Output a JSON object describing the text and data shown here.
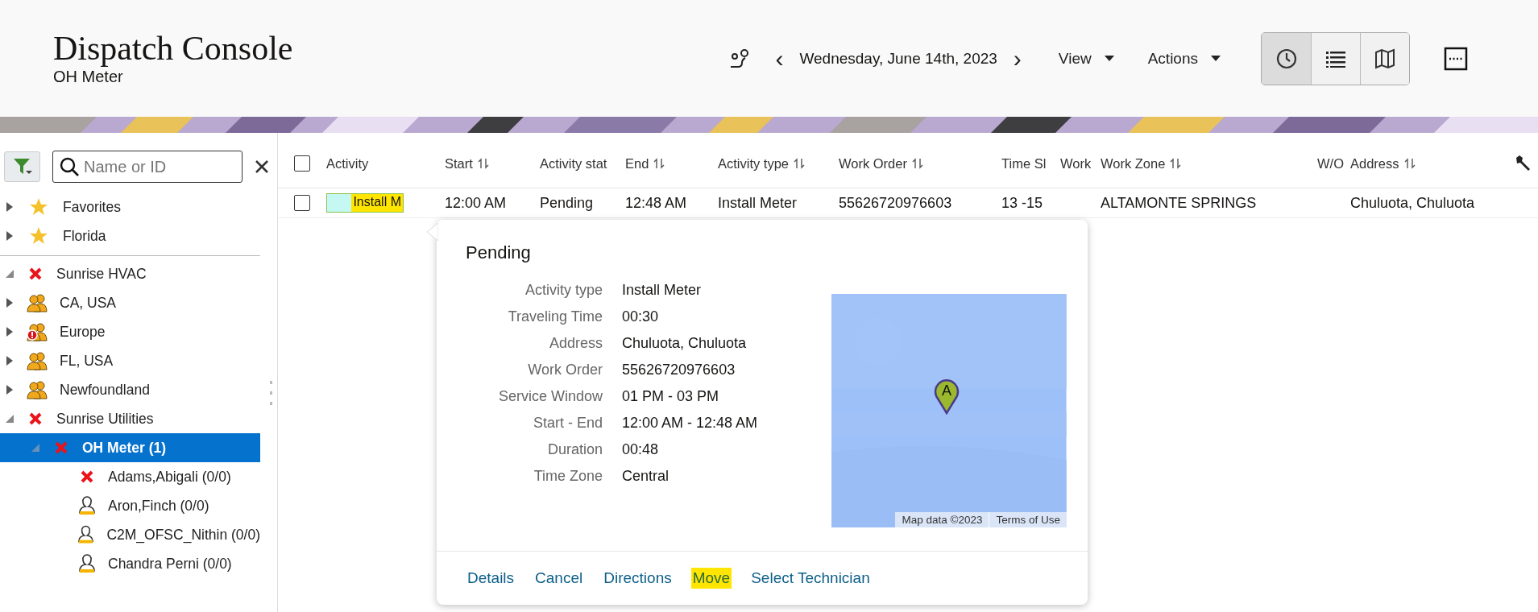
{
  "header": {
    "title": "Dispatch Console",
    "subtitle": "OH Meter",
    "date": "Wednesday, June 14th, 2023",
    "prev": "‹",
    "next": "›",
    "menus": [
      {
        "label": "View"
      },
      {
        "label": "Actions"
      }
    ],
    "view_modes": [
      {
        "kind": "clock",
        "selected": true
      },
      {
        "kind": "list",
        "selected": false
      },
      {
        "kind": "map",
        "selected": false
      }
    ]
  },
  "sidebar": {
    "search": {
      "placeholder": "Name or ID"
    },
    "favorites": [
      {
        "label": "Favorites",
        "kind": "star",
        "expanded": false
      },
      {
        "label": "Florida",
        "kind": "star",
        "expanded": false
      }
    ],
    "tree": [
      {
        "label": "Sunrise HVAC",
        "kind": "x",
        "expanded": true,
        "selected": false
      },
      {
        "label": "CA, USA",
        "kind": "group",
        "expanded": false,
        "selected": false
      },
      {
        "label": "Europe",
        "kind": "group-alert",
        "expanded": false,
        "selected": false
      },
      {
        "label": "FL, USA",
        "kind": "group",
        "expanded": false,
        "selected": false
      },
      {
        "label": "Newfoundland",
        "kind": "group",
        "expanded": false,
        "selected": false
      },
      {
        "label": "Sunrise Utilities",
        "kind": "x",
        "expanded": true,
        "selected": false,
        "children": [
          {
            "label": "OH Meter (1)",
            "kind": "x",
            "expanded": true,
            "selected": true,
            "children": [
              {
                "label": "Adams,Abigali (0/0)",
                "kind": "x",
                "selected": false
              },
              {
                "label": "Aron,Finch (0/0)",
                "kind": "person",
                "selected": false
              },
              {
                "label": "C2M_OFSC_Nithin (0/0)",
                "kind": "person",
                "selected": false
              },
              {
                "label": "Chandra Perni (0/0)",
                "kind": "person",
                "selected": false
              }
            ]
          }
        ]
      }
    ]
  },
  "table": {
    "all_checked": false,
    "columns": [
      {
        "label": "Activity",
        "sortable": false
      },
      {
        "label": "Start",
        "sortable": true
      },
      {
        "label": "Activity stat",
        "sortable": false
      },
      {
        "label": "End",
        "sortable": true
      },
      {
        "label": "Activity type",
        "sortable": true
      },
      {
        "label": "Work Order",
        "sortable": true
      },
      {
        "label": "Time Sl",
        "sortable": false
      },
      {
        "label": "Work",
        "sortable": false
      },
      {
        "label": "Work Zone",
        "sortable": true
      },
      {
        "label": "W/O",
        "sortable": false
      },
      {
        "label": "Address",
        "sortable": true
      }
    ],
    "rows": [
      {
        "checked": false,
        "activity": {
          "text": "Install M",
          "highlighted": true
        },
        "start": "12:00 AM",
        "status": "Pending",
        "end": "12:48 AM",
        "activity_type": "Install Meter",
        "work_order": "55626720976603",
        "time_slot": "13 -15",
        "work_zone": "ALTAMONTE SPRINGS",
        "address": "Chuluota, Chuluota"
      }
    ]
  },
  "popup": {
    "title": "Pending",
    "details": [
      {
        "label": "Activity type",
        "value": "Install Meter"
      },
      {
        "label": "Traveling Time",
        "value": "00:30"
      },
      {
        "label": "Address",
        "value": "Chuluota, Chuluota"
      },
      {
        "label": "Work Order",
        "value": "55626720976603"
      },
      {
        "label": "Service Window",
        "value": "01 PM - 03 PM"
      },
      {
        "label": "Start - End",
        "value": "12:00 AM - 12:48 AM"
      },
      {
        "label": "Duration",
        "value": "00:48"
      },
      {
        "label": "Time Zone",
        "value": "Central"
      }
    ],
    "map": {
      "marker": "A",
      "attribution": "Map data ©2023",
      "terms": "Terms of Use"
    },
    "actions": [
      {
        "label": "Details",
        "highlighted": false
      },
      {
        "label": "Cancel",
        "highlighted": false
      },
      {
        "label": "Directions",
        "highlighted": false
      },
      {
        "label": "Move",
        "highlighted": true
      },
      {
        "label": "Select Technician",
        "highlighted": false
      }
    ]
  }
}
